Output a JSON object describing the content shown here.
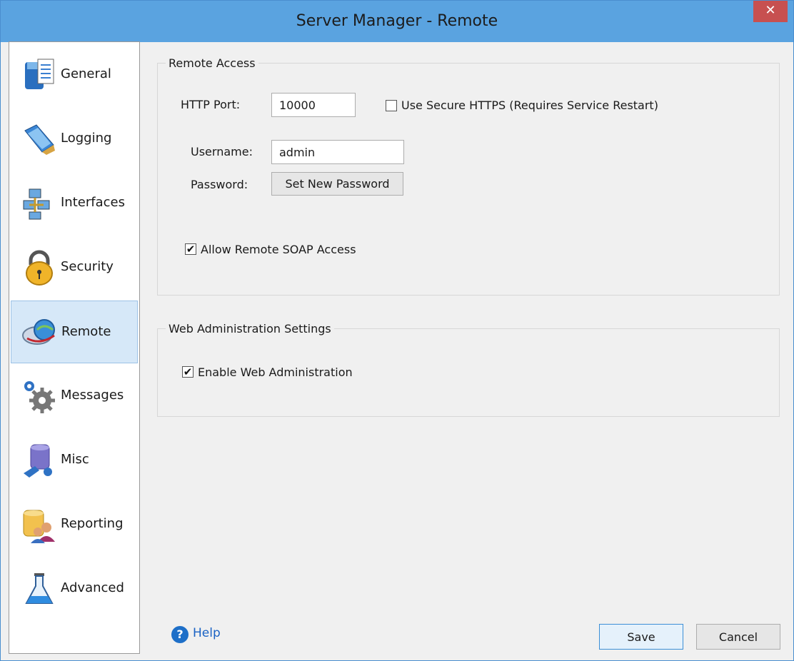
{
  "window": {
    "title": "Server Manager - Remote",
    "close_glyph": "✕"
  },
  "sidebar": {
    "items": [
      {
        "label": "General",
        "icon": "general-icon"
      },
      {
        "label": "Logging",
        "icon": "logging-icon"
      },
      {
        "label": "Interfaces",
        "icon": "interfaces-icon"
      },
      {
        "label": "Security",
        "icon": "security-icon"
      },
      {
        "label": "Remote",
        "icon": "remote-icon",
        "active": true
      },
      {
        "label": "Messages",
        "icon": "messages-icon"
      },
      {
        "label": "Misc",
        "icon": "misc-icon"
      },
      {
        "label": "Reporting",
        "icon": "reporting-icon"
      },
      {
        "label": "Advanced",
        "icon": "advanced-icon"
      }
    ]
  },
  "remote_access": {
    "title": "Remote Access",
    "http_port_label": "HTTP Port:",
    "http_port_value": "10000",
    "use_https_label": "Use Secure HTTPS (Requires Service Restart)",
    "use_https_checked": false,
    "username_label": "Username:",
    "username_value": "admin",
    "password_label": "Password:",
    "set_password_label": "Set New Password",
    "allow_soap_label": "Allow Remote SOAP Access",
    "allow_soap_checked": true
  },
  "web_admin": {
    "title": "Web Administration Settings",
    "enable_label": "Enable Web Administration",
    "enable_checked": true
  },
  "footer": {
    "help_label": "Help",
    "save_label": "Save",
    "cancel_label": "Cancel"
  },
  "colors": {
    "titlebar": "#5aa3e0",
    "close": "#c75050",
    "active_nav": "#d6e8f8"
  }
}
